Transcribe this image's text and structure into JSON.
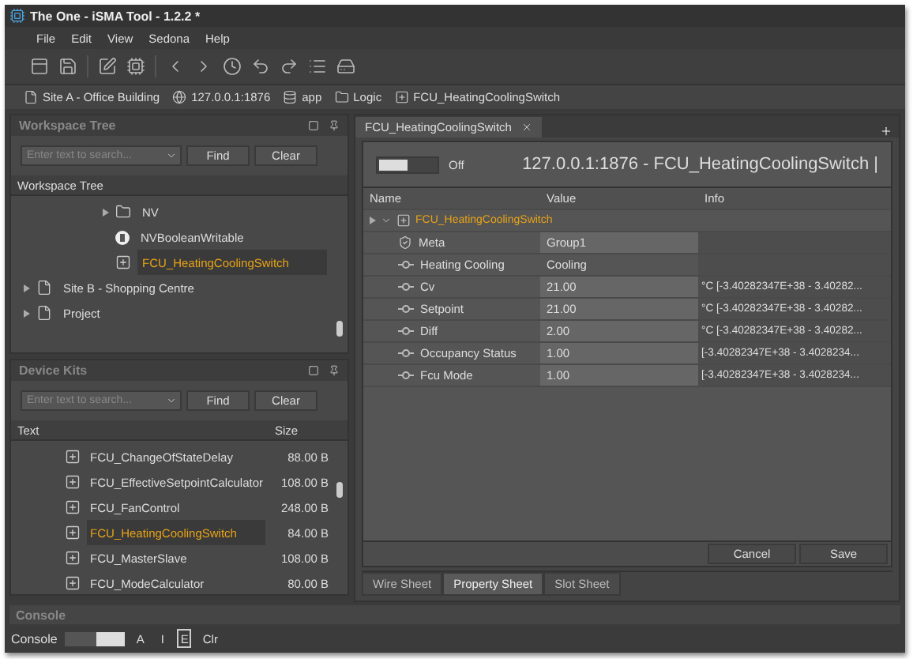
{
  "window": {
    "title": "The One - iSMA Tool - 1.2.2 *"
  },
  "menu": [
    "File",
    "Edit",
    "View",
    "Sedona",
    "Help"
  ],
  "breadcrumb": [
    {
      "label": "Site A - Office Building",
      "kind": "page"
    },
    {
      "label": "127.0.0.1:1876",
      "kind": "server"
    },
    {
      "label": "app",
      "kind": "database"
    },
    {
      "label": "Logic",
      "kind": "folder"
    },
    {
      "label": "FCU_HeatingCoolingSwitch",
      "kind": "component"
    }
  ],
  "workspace_tree": {
    "title": "Workspace Tree",
    "search": {
      "placeholder": "Enter text to search..."
    },
    "find": "Find",
    "clear": "Clear",
    "header": "Workspace Tree",
    "nested_items": [
      {
        "label": "NV",
        "kind": "folder",
        "expandable": true,
        "selected": false
      },
      {
        "label": "NVBooleanWritable",
        "kind": "boolean",
        "expandable": false,
        "selected": false
      },
      {
        "label": "FCU_HeatingCoolingSwitch",
        "kind": "component",
        "expandable": false,
        "selected": true
      }
    ],
    "items": [
      {
        "label": "Site B - Shopping Centre",
        "kind": "page",
        "expandable": true,
        "selected": false
      },
      {
        "label": "Project",
        "kind": "page",
        "expandable": true,
        "selected": false
      }
    ]
  },
  "device_kits": {
    "title": "Device Kits",
    "search": {
      "placeholder": "Enter text to search..."
    },
    "find": "Find",
    "clear": "Clear",
    "columns": [
      "Text",
      "Size"
    ],
    "rows": [
      {
        "name": "FCU_ChangeOfStateDelay",
        "size": "88.00 B",
        "selected": false
      },
      {
        "name": "FCU_EffectiveSetpointCalculator",
        "size": "108.00 B",
        "selected": false
      },
      {
        "name": "FCU_FanControl",
        "size": "248.00 B",
        "selected": false
      },
      {
        "name": "FCU_HeatingCoolingSwitch",
        "size": "84.00 B",
        "selected": true
      },
      {
        "name": "FCU_MasterSlave",
        "size": "108.00 B",
        "selected": false
      },
      {
        "name": "FCU_ModeCalculator",
        "size": "80.00 B",
        "selected": false
      }
    ]
  },
  "editor": {
    "tab": "FCU_HeatingCoolingSwitch",
    "toggle": {
      "label": "Off",
      "on": false
    },
    "heading": "127.0.0.1:1876 - FCU_HeatingCoolingSwitch |",
    "columns": [
      "Name",
      "Value",
      "Info"
    ],
    "root": "FCU_HeatingCoolingSwitch",
    "properties": [
      {
        "name": "Meta",
        "value": "Group1",
        "kind": "meta",
        "editable": true
      },
      {
        "name": "Heating Cooling",
        "value": "Cooling",
        "kind": "slot",
        "editable": false
      },
      {
        "name": "Cv",
        "value": "21.00",
        "info": "°C  [-3.40282347E+38 - 3.40282...",
        "kind": "slot",
        "editable": true
      },
      {
        "name": "Setpoint",
        "value": "21.00",
        "info": "°C  [-3.40282347E+38 - 3.40282...",
        "kind": "slot",
        "editable": true
      },
      {
        "name": "Diff",
        "value": "2.00",
        "info": "°C  [-3.40282347E+38 - 3.40282...",
        "kind": "slot",
        "editable": true
      },
      {
        "name": "Occupancy Status",
        "value": "1.00",
        "info": "[-3.40282347E+38 - 3.4028234...",
        "kind": "slot",
        "editable": true
      },
      {
        "name": "Fcu Mode",
        "value": "1.00",
        "info": "[-3.40282347E+38 - 3.4028234...",
        "kind": "slot",
        "editable": true
      }
    ],
    "buttons": [
      "Cancel",
      "Save"
    ],
    "sheet_tabs": [
      {
        "label": "Wire Sheet",
        "selected": false
      },
      {
        "label": "Property Sheet",
        "selected": true
      },
      {
        "label": "Slot Sheet",
        "selected": false
      }
    ]
  },
  "console": {
    "title": "Console",
    "label": "Console",
    "filters": [
      {
        "label": "A",
        "selected": false
      },
      {
        "label": "I",
        "selected": false
      },
      {
        "label": "E",
        "selected": true
      },
      {
        "label": "Clr",
        "selected": false
      }
    ]
  }
}
